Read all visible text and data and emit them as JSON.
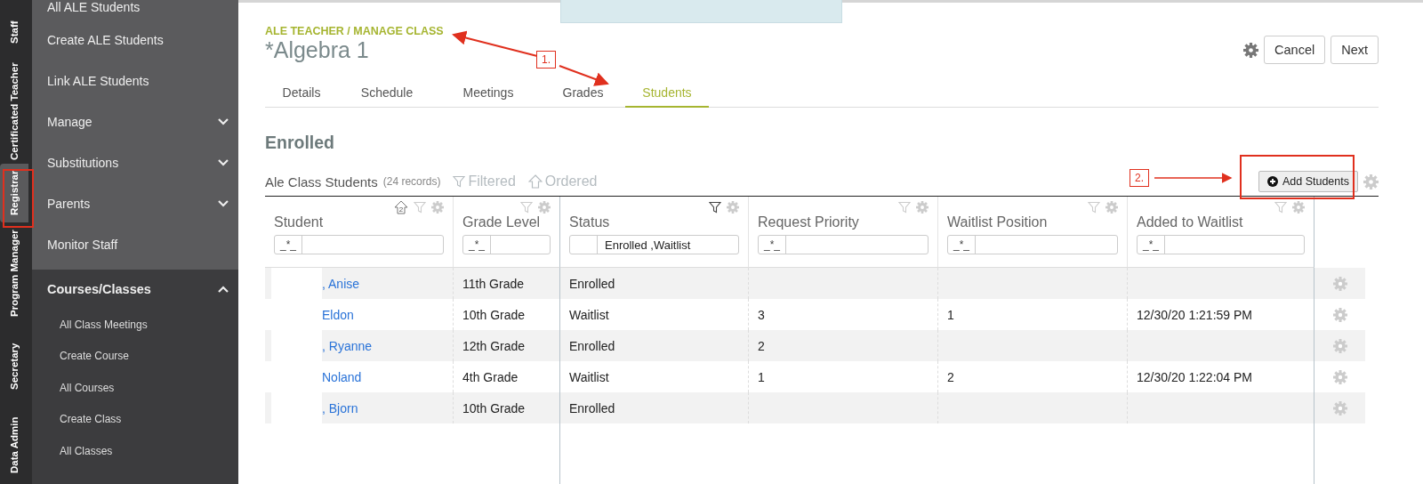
{
  "rail": {
    "tabs": [
      {
        "label": "Staff",
        "selected": false
      },
      {
        "label": "Certificated Teacher",
        "selected": false
      },
      {
        "label": "Registrar",
        "selected": true
      },
      {
        "label": "Program Manager",
        "selected": false
      },
      {
        "label": "Secretary",
        "selected": false
      },
      {
        "label": "Data Admin",
        "selected": false
      }
    ]
  },
  "sidebar": {
    "items": [
      {
        "label": "All ALE Students",
        "kind": "link"
      },
      {
        "label": "Create ALE Students",
        "kind": "link"
      },
      {
        "label": "Link ALE Students",
        "kind": "link"
      },
      {
        "label": "Manage",
        "kind": "group",
        "expanded": false
      },
      {
        "label": "Substitutions",
        "kind": "group",
        "expanded": false
      },
      {
        "label": "Parents",
        "kind": "group",
        "expanded": false
      },
      {
        "label": "Monitor Staff",
        "kind": "link"
      }
    ],
    "section": {
      "label": "Courses/Classes",
      "expanded": true,
      "items": [
        "All Class Meetings",
        "Create Course",
        "All Courses",
        "Create Class",
        "All Classes"
      ]
    }
  },
  "header": {
    "breadcrumb": "ALE TEACHER / MANAGE CLASS",
    "title": "*Algebra 1",
    "buttons": [
      "Cancel",
      "Next"
    ]
  },
  "tabs": [
    {
      "label": "Details",
      "selected": false
    },
    {
      "label": "Schedule",
      "selected": false
    },
    {
      "label": "Meetings",
      "selected": false
    },
    {
      "label": "Grades",
      "selected": false
    },
    {
      "label": "Students",
      "selected": true
    }
  ],
  "section_title": "Enrolled",
  "grid": {
    "title": "Ale Class Students",
    "record_count": "(24 records)",
    "filtered": "Filtered",
    "ordered": "Ordered",
    "add_button": "Add Students",
    "columns": [
      {
        "label": "Student",
        "kind": "link",
        "filter_prefix": "_*_",
        "sort_badge": "2",
        "filter_active": false
      },
      {
        "label": "Grade Level",
        "kind": "text",
        "filter_prefix": "_*_",
        "filter_active": false
      },
      {
        "label": "Status",
        "kind": "text",
        "filter_value": "Enrolled ,Waitlist",
        "filter_active": true
      },
      {
        "label": "Request Priority",
        "kind": "text",
        "filter_prefix": "_*_",
        "filter_active": false
      },
      {
        "label": "Waitlist Position",
        "kind": "text",
        "filter_prefix": "_*_",
        "filter_active": false
      },
      {
        "label": "Added to Waitlist",
        "kind": "text",
        "filter_prefix": "_*_",
        "filter_active": false
      }
    ],
    "rows": [
      {
        "cells": [
          ", Anise",
          "11th Grade",
          "Enrolled",
          "",
          "",
          ""
        ]
      },
      {
        "cells": [
          "Eldon",
          "10th Grade",
          "Waitlist",
          "3",
          "1",
          "12/30/20 1:21:59 PM"
        ]
      },
      {
        "cells": [
          ", Ryanne",
          "12th Grade",
          "Enrolled",
          "2",
          "",
          ""
        ]
      },
      {
        "cells": [
          "Noland",
          "4th Grade",
          "Waitlist",
          "1",
          "2",
          "12/30/20 1:22:04 PM"
        ]
      },
      {
        "cells": [
          ", Bjorn",
          "10th Grade",
          "Enrolled",
          "",
          "",
          ""
        ]
      }
    ]
  },
  "annotations": [
    {
      "label": "1."
    },
    {
      "label": "2."
    }
  ]
}
